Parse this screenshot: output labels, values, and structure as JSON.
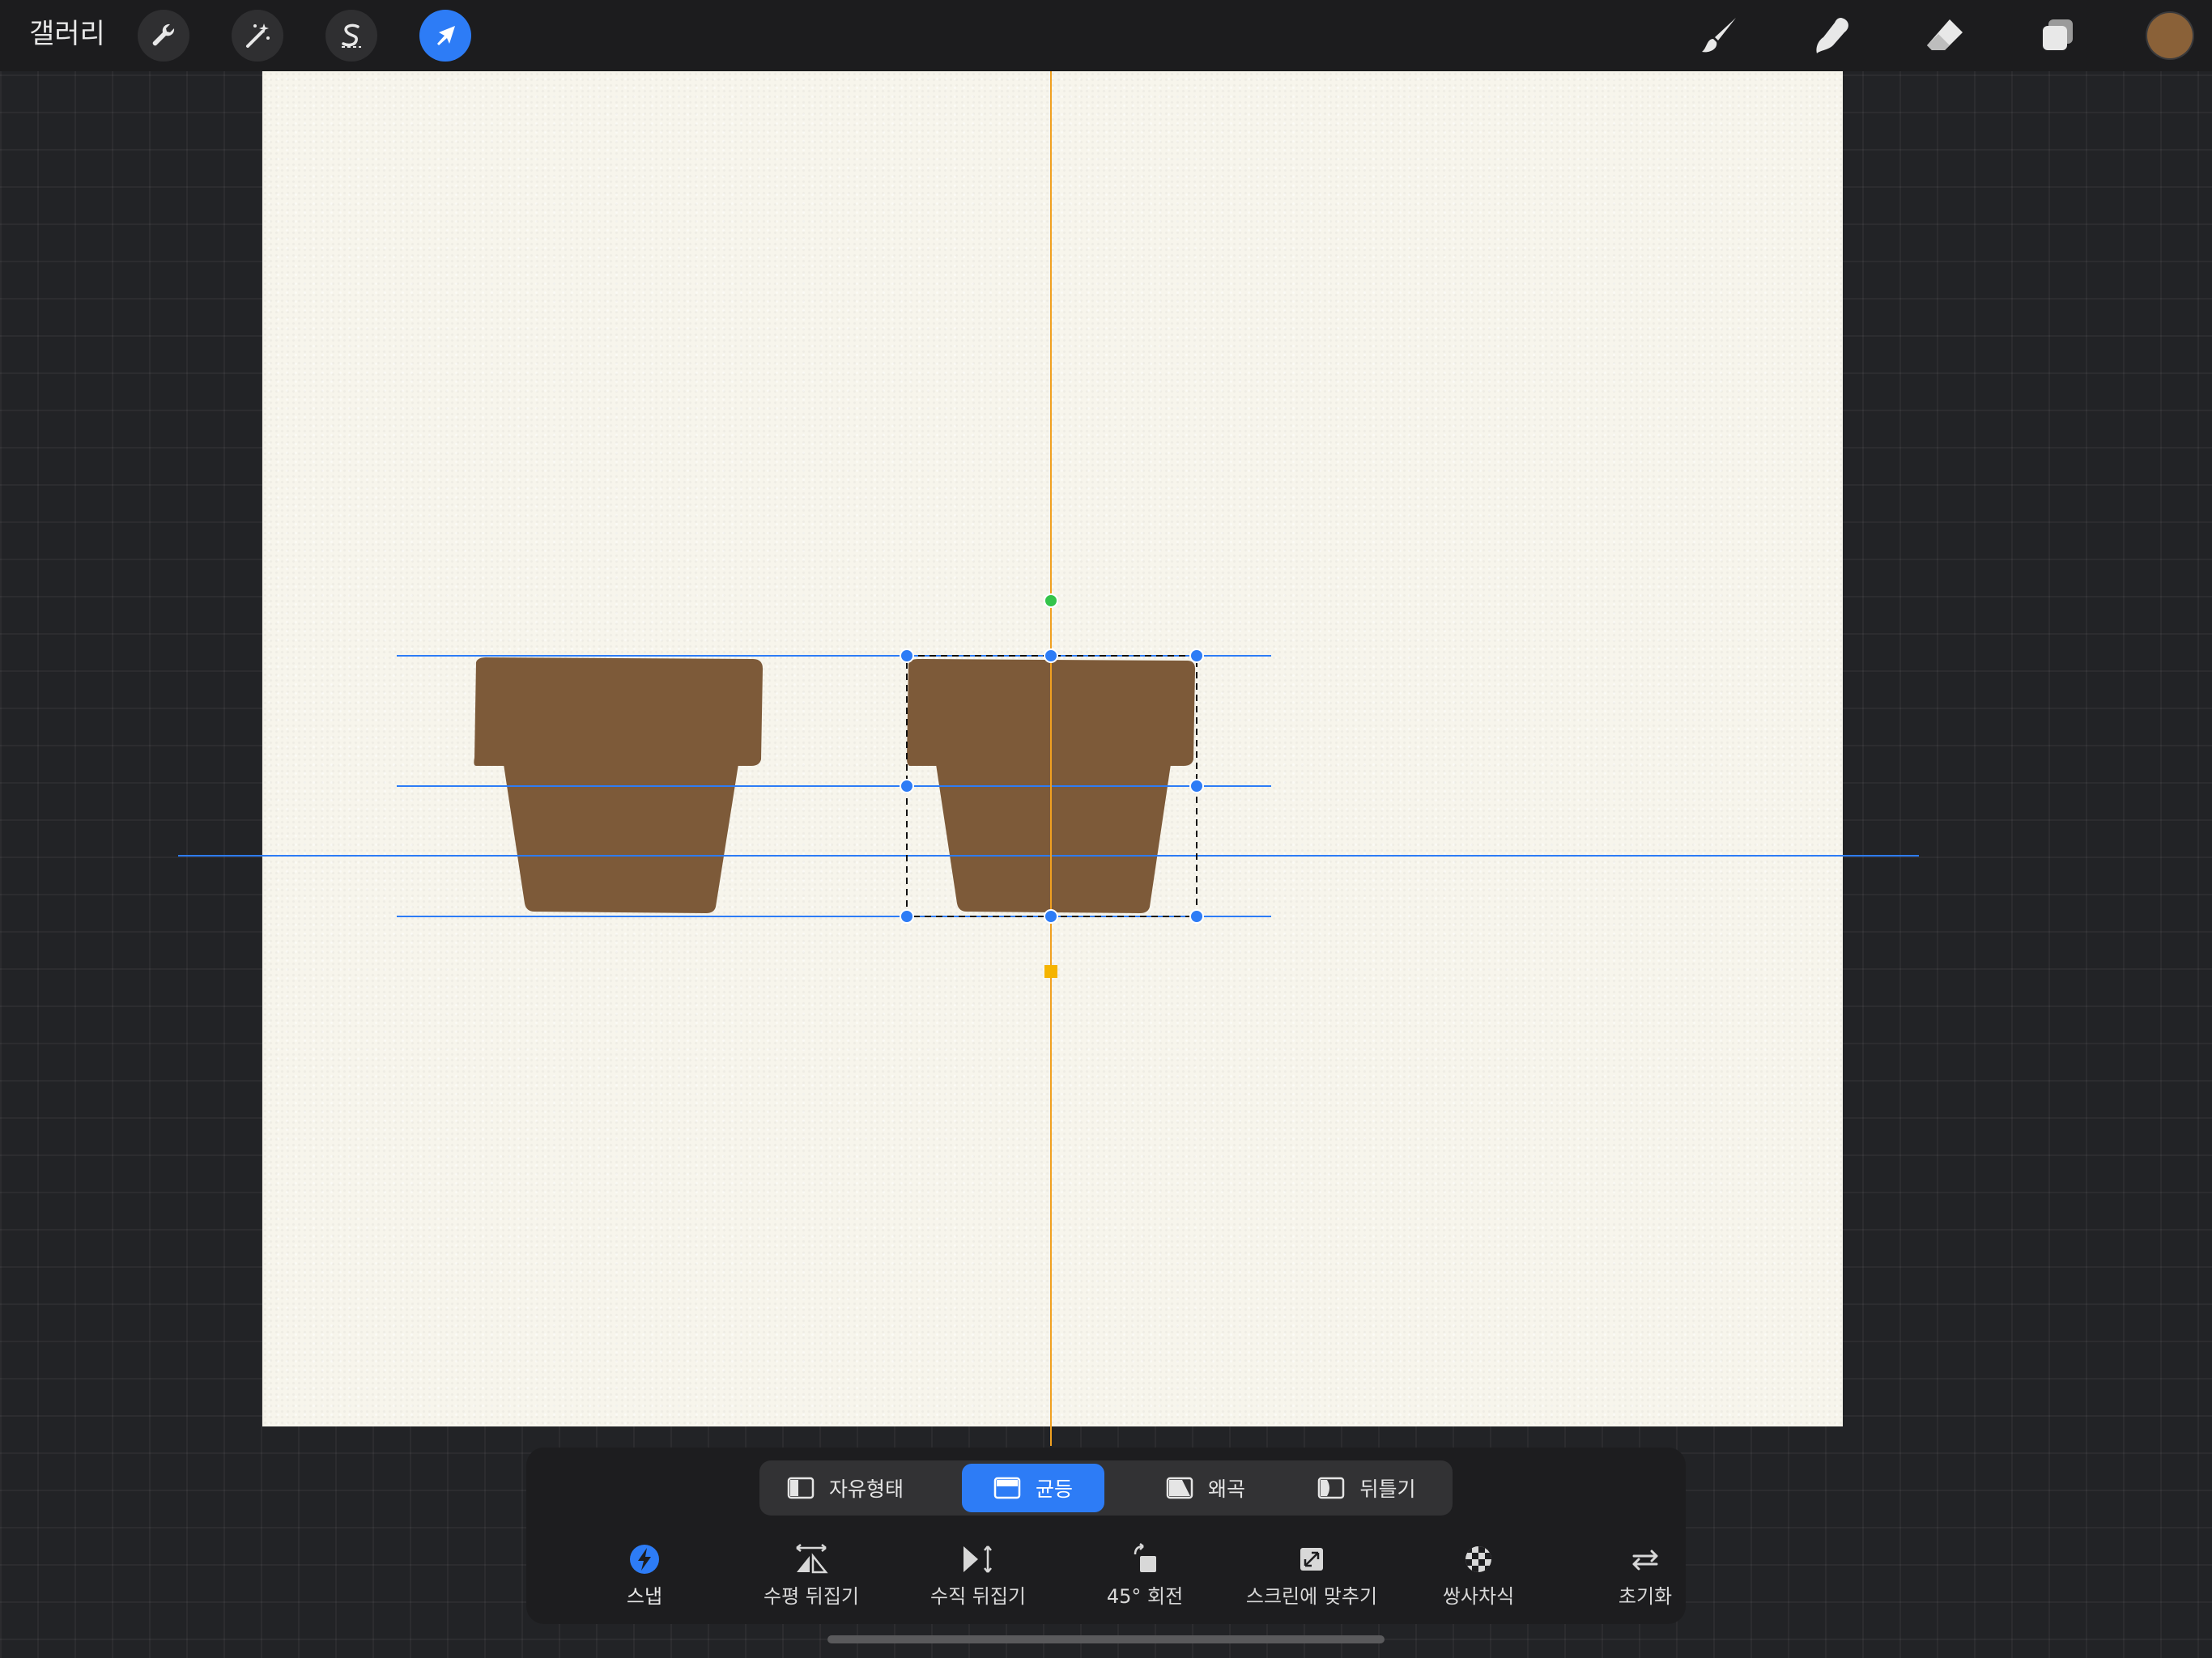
{
  "topbar": {
    "gallery_label": "갤러리",
    "left_tools": [
      {
        "name": "actions",
        "icon": "wrench-icon"
      },
      {
        "name": "adjustments",
        "icon": "magic-wand-icon"
      },
      {
        "name": "selection",
        "icon": "selection-s-icon"
      },
      {
        "name": "transform",
        "icon": "arrow-cursor-icon",
        "active": true
      }
    ],
    "right_tools": [
      {
        "name": "brush",
        "icon": "brush-icon"
      },
      {
        "name": "smudge",
        "icon": "smudge-finger-icon"
      },
      {
        "name": "eraser",
        "icon": "eraser-icon"
      },
      {
        "name": "layers",
        "icon": "layers-icon"
      }
    ],
    "current_color": "#8A6138"
  },
  "canvas": {
    "paper_color": "#F7F5EC",
    "shape_color": "#7D5A39",
    "guide_vertical_color": "#F0A020",
    "guide_horizontal_color": "#2D7CF6"
  },
  "transform_panel": {
    "modes": [
      {
        "id": "freeform",
        "label": "자유형태",
        "icon": "freeform-icon",
        "active": false
      },
      {
        "id": "uniform",
        "label": "균등",
        "icon": "uniform-icon",
        "active": true
      },
      {
        "id": "distort",
        "label": "왜곡",
        "icon": "distort-icon",
        "active": false
      },
      {
        "id": "warp",
        "label": "뒤틀기",
        "icon": "warp-icon",
        "active": false
      }
    ],
    "actions": [
      {
        "id": "snap",
        "label": "스냅",
        "icon": "snap-lightning-icon",
        "active": true
      },
      {
        "id": "flip_h",
        "label": "수평 뒤집기",
        "icon": "flip-horizontal-icon"
      },
      {
        "id": "flip_v",
        "label": "수직 뒤집기",
        "icon": "flip-vertical-icon"
      },
      {
        "id": "rotate45",
        "label": "45° 회전",
        "icon": "rotate-45-icon"
      },
      {
        "id": "fit",
        "label": "스크린에 맞추기",
        "icon": "fit-to-screen-icon"
      },
      {
        "id": "interp",
        "label": "쌍사차식",
        "icon": "interpolation-checker-icon"
      },
      {
        "id": "reset",
        "label": "초기화",
        "icon": "reset-arrows-icon"
      }
    ]
  }
}
